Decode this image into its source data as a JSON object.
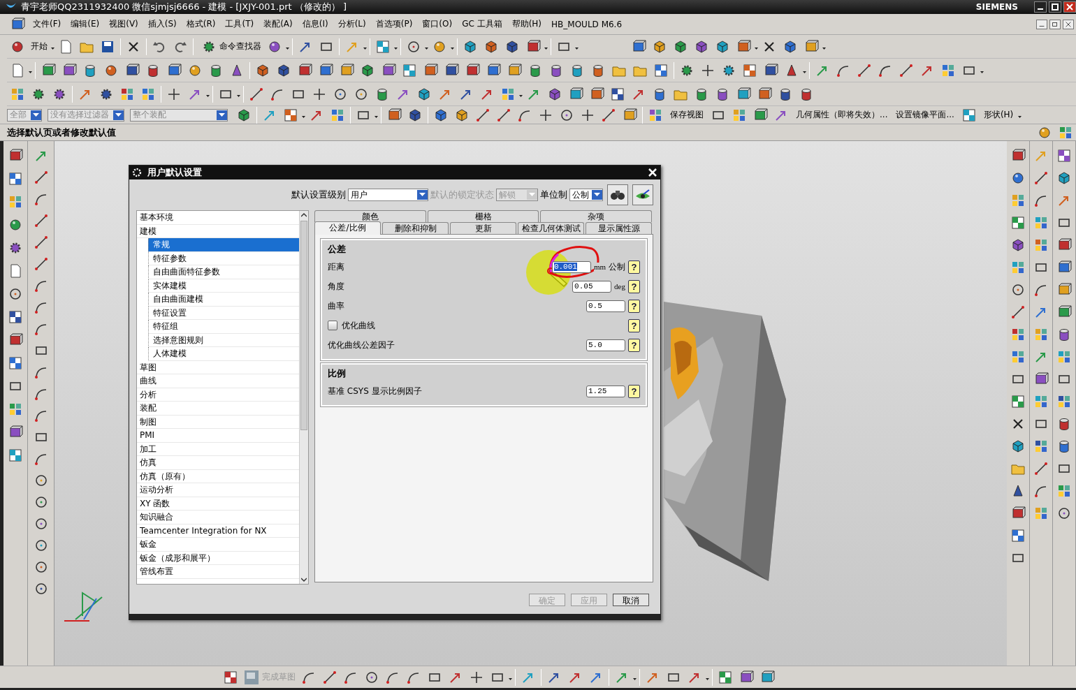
{
  "window": {
    "title": "青宇老师QQ2311932400 微信sjmjsj6666 - 建模 - [JXJY-001.prt （修改的） ]",
    "brand": "SIEMENS"
  },
  "menu": [
    "文件(F)",
    "编辑(E)",
    "视图(V)",
    "插入(S)",
    "格式(R)",
    "工具(T)",
    "装配(A)",
    "信息(I)",
    "分析(L)",
    "首选项(P)",
    "窗口(O)",
    "GC 工具箱",
    "帮助(H)",
    "HB_MOULD M6.6"
  ],
  "toolbar": {
    "start": "开始",
    "finder": "命令查找器"
  },
  "selection_bar": {
    "type_filter": "全部",
    "selection_filter": "没有选择过滤器",
    "scope": "整个装配",
    "save_view": "保存视图",
    "geometry_props": "几何属性（即将失效）...",
    "mirror_plane": "设置镜像平面...",
    "shape": "形状(H)"
  },
  "cue": "选择默认页或者修改默认值",
  "dialog": {
    "title": "用户默认设置",
    "level_label": "默认设置级别",
    "level": "用户",
    "lock_label": "默认的锁定状态",
    "lock": "解锁",
    "lock_disabled": true,
    "units_label": "单位制",
    "units": "公制",
    "tree": [
      {
        "label": "基本环境",
        "selected": false
      },
      {
        "label": "建模",
        "selected": false,
        "children": [
          {
            "label": "常规",
            "selected": true
          },
          {
            "label": "特征参数",
            "selected": false
          },
          {
            "label": "自由曲面特征参数",
            "selected": false
          },
          {
            "label": "实体建模",
            "selected": false
          },
          {
            "label": "自由曲面建模",
            "selected": false
          },
          {
            "label": "特征设置",
            "selected": false
          },
          {
            "label": "特征组",
            "selected": false
          },
          {
            "label": "选择意图规则",
            "selected": false
          },
          {
            "label": "人体建模",
            "selected": false
          }
        ]
      },
      {
        "label": "草图",
        "selected": false
      },
      {
        "label": "曲线",
        "selected": false
      },
      {
        "label": "分析",
        "selected": false
      },
      {
        "label": "装配",
        "selected": false
      },
      {
        "label": "制图",
        "selected": false
      },
      {
        "label": "PMI",
        "selected": false
      },
      {
        "label": "加工",
        "selected": false
      },
      {
        "label": "仿真",
        "selected": false
      },
      {
        "label": "仿真（原有）",
        "selected": false
      },
      {
        "label": "运动分析",
        "selected": false
      },
      {
        "label": "XY 函数",
        "selected": false
      },
      {
        "label": "知识融合",
        "selected": false
      },
      {
        "label": "Teamcenter Integration for NX",
        "selected": false
      },
      {
        "label": "钣金",
        "selected": false
      },
      {
        "label": "钣金（成形和展平）",
        "selected": false
      },
      {
        "label": "管线布置",
        "selected": false
      }
    ],
    "tab_rows": [
      [
        {
          "label": "颜色",
          "selected": false
        },
        {
          "label": "栅格",
          "selected": false
        },
        {
          "label": "杂项",
          "selected": false
        }
      ],
      [
        {
          "label": "公差/比例",
          "selected": true
        },
        {
          "label": "删除和抑制",
          "selected": false
        },
        {
          "label": "更新",
          "selected": false
        },
        {
          "label": "检查几何体测试",
          "selected": false
        },
        {
          "label": "显示属性源",
          "selected": false
        }
      ]
    ],
    "groups": [
      {
        "title": "公差",
        "rows": [
          {
            "kind": "field",
            "label": "距离",
            "value": "0.001",
            "selected": true,
            "unit": "mm",
            "unit_system": "公制",
            "help": "?"
          },
          {
            "kind": "field",
            "label": "角度",
            "value": "0.05",
            "selected": false,
            "unit": "deg",
            "help": "?"
          },
          {
            "kind": "field",
            "label": "曲率",
            "value": "0.5",
            "selected": false,
            "help": "?"
          },
          {
            "kind": "checkbox",
            "label": "优化曲线",
            "checked": false,
            "help": "?"
          },
          {
            "kind": "field",
            "label": "优化曲线公差因子",
            "value": "5.0",
            "selected": false,
            "help": "?"
          }
        ]
      },
      {
        "title": "比例",
        "rows": [
          {
            "kind": "field",
            "label": "基准 CSYS 显示比例因子",
            "value": "1.25",
            "selected": false,
            "help": "?"
          }
        ]
      }
    ],
    "buttons": [
      {
        "label": "确定",
        "disabled": true
      },
      {
        "label": "应用",
        "disabled": true
      },
      {
        "label": "取消",
        "disabled": false
      }
    ]
  },
  "sketch_toolbar": {
    "finish": "完成草图",
    "finish_disabled": true
  }
}
